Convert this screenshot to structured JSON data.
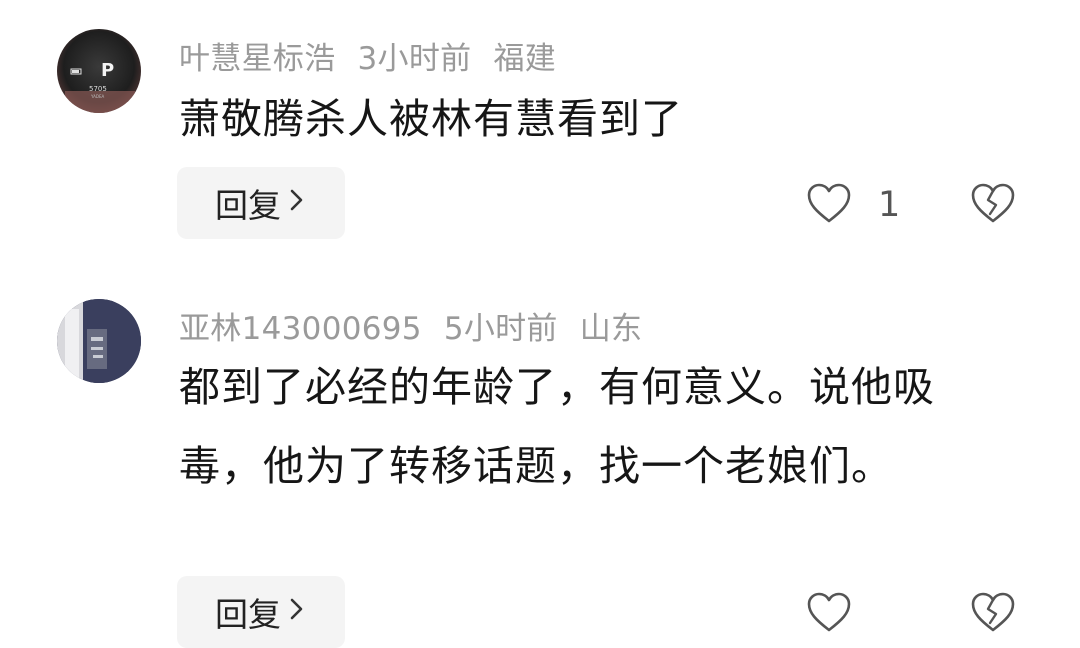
{
  "comments": [
    {
      "username": "叶慧星标浩",
      "time": "3小时前",
      "location": "福建",
      "text": "萧敬腾杀人被林有慧看到了",
      "reply_label": "回复",
      "like_count": "1",
      "avatar": "car-dashboard-avatar"
    },
    {
      "username": "亚林143000695",
      "time": "5小时前",
      "location": "山东",
      "text": "都到了必经的年龄了，有何意义。说他吸毒，他为了转移话题，找一个老娘们。",
      "reply_label": "回复",
      "like_count": "",
      "avatar": "dark-photo-avatar"
    }
  ],
  "icons": {
    "like": "heart-outline-icon",
    "dislike": "broken-heart-icon",
    "reply_chevron": "chevron-right-icon"
  },
  "colors": {
    "meta_text": "#9a9a9a",
    "body_text": "#161616",
    "reply_bg": "#f4f4f4",
    "icon": "#555555"
  }
}
